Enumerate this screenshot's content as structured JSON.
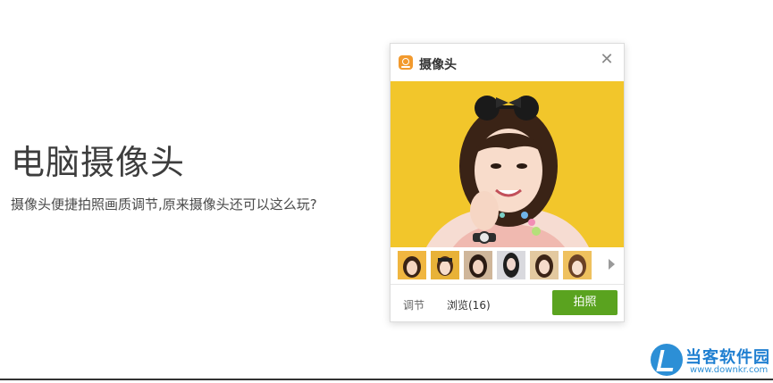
{
  "hero": {
    "title": "电脑摄像头",
    "subtitle": "摄像头便捷拍照画质调节,原来摄像头还可以这么玩?"
  },
  "window": {
    "title": "摄像头",
    "icon": "camera-app-icon",
    "close_glyph": "✕",
    "thumbnails_count": 6,
    "footer": {
      "adjust_label": "调节",
      "browse_label": "浏览(16)",
      "snap_label": "拍照"
    }
  },
  "watermark": {
    "name": "当客软件园",
    "url": "www.downkr.com"
  },
  "colors": {
    "accent_green": "#5aa31f",
    "preview_yellow": "#f2c62b",
    "app_icon_orange": "#f29a2e",
    "watermark_blue": "#1f7fd1"
  }
}
